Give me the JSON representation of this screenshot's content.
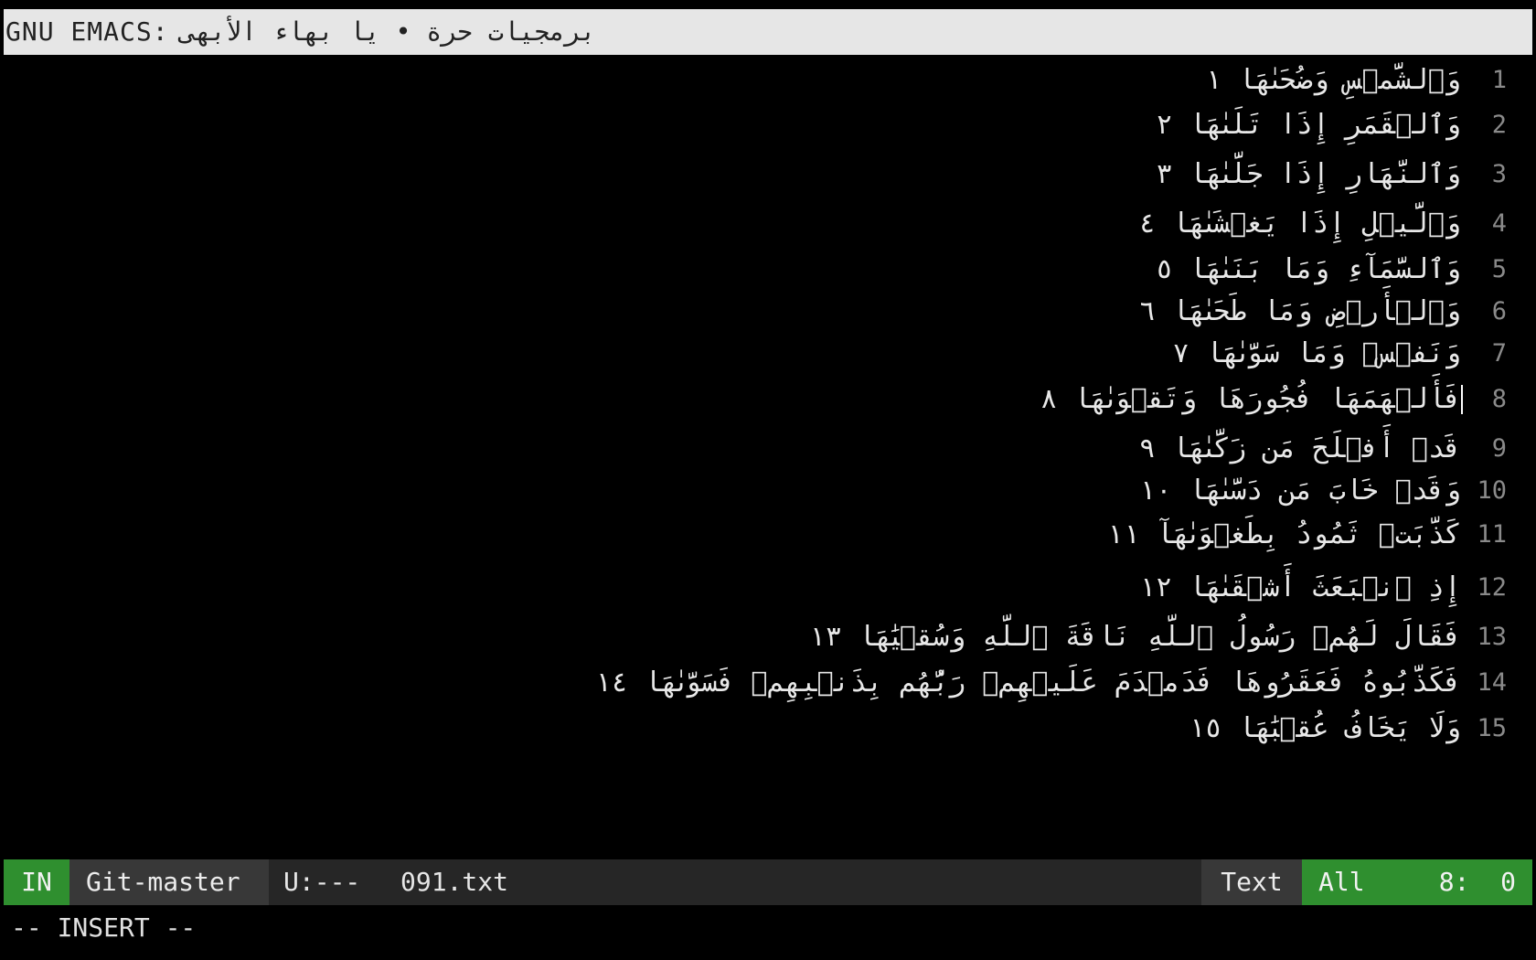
{
  "window": {
    "app_name": "GNU EMACS:",
    "title_text": "برمجيات حرة • يا بهاء الأبهى"
  },
  "editor": {
    "lines": [
      {
        "number": "1",
        "text": "وَٱلشَّمۡسِ وَضُحَىٰهَا ١"
      },
      {
        "number": "2",
        "text": "وَٱلۡقَمَرِ إِذَا تَلَىٰهَا ٢"
      },
      {
        "number": "3",
        "text": "وَٱلنَّهَارِ إِذَا جَلَّىٰهَا ٣"
      },
      {
        "number": "4",
        "text": "وَٱلَّيۡلِ إِذَا يَغۡشَىٰهَا ٤"
      },
      {
        "number": "5",
        "text": "وَٱلسَّمَآءِ وَمَا بَنَىٰهَا ٥"
      },
      {
        "number": "6",
        "text": "وَٱلۡأَرۡضِ وَمَا طَحَىٰهَا ٦"
      },
      {
        "number": "7",
        "text": "وَنَفۡسٖ وَمَا سَوَّىٰهَا ٧"
      },
      {
        "number": "8",
        "text": "فَأَلۡهَمَهَا فُجُورَهَا وَتَقۡوَىٰهَا ٨"
      },
      {
        "number": "9",
        "text": "قَدۡ أَفۡلَحَ مَن زَكَّىٰهَا ٩"
      },
      {
        "number": "10",
        "text": "وَقَدۡ خَابَ مَن دَسَّىٰهَا ١٠"
      },
      {
        "number": "11",
        "text": "كَذَّبَتۡ ثَمُودُ بِطَغۡوَىٰهَآ ١١"
      },
      {
        "number": "12",
        "text": "إِذِ ٱنۢبَعَثَ أَشۡقَىٰهَا ١٢"
      },
      {
        "number": "13",
        "text": "فَقَالَ لَهُمۡ رَسُولُ ٱللَّهِ نَاقَةَ ٱللَّهِ وَسُقۡيَٰهَا ١٣"
      },
      {
        "number": "14",
        "text": "فَكَذَّبُوهُ فَعَقَرُوهَا فَدَمۡدَمَ عَلَيۡهِمۡ رَبُّهُم بِذَنۢبِهِمۡ فَسَوَّىٰهَا ١٤"
      },
      {
        "number": "15",
        "text": "وَلَا يَخَافُ عُقۡبَٰهَا ١٥"
      }
    ]
  },
  "modeline": {
    "state": "IN",
    "branch": "Git-master",
    "status": "U:---",
    "filename": "091.txt",
    "major_mode": "Text",
    "scroll": "All",
    "position": "8:  0"
  },
  "minibuffer": {
    "message": "-- INSERT --"
  },
  "colors": {
    "background": "#000000",
    "titlebar": "#e6e6e6",
    "modeline": "#262626",
    "state_accent": "#2f8f2f",
    "segment": "#383838",
    "line_number": "#8a8a8a"
  }
}
